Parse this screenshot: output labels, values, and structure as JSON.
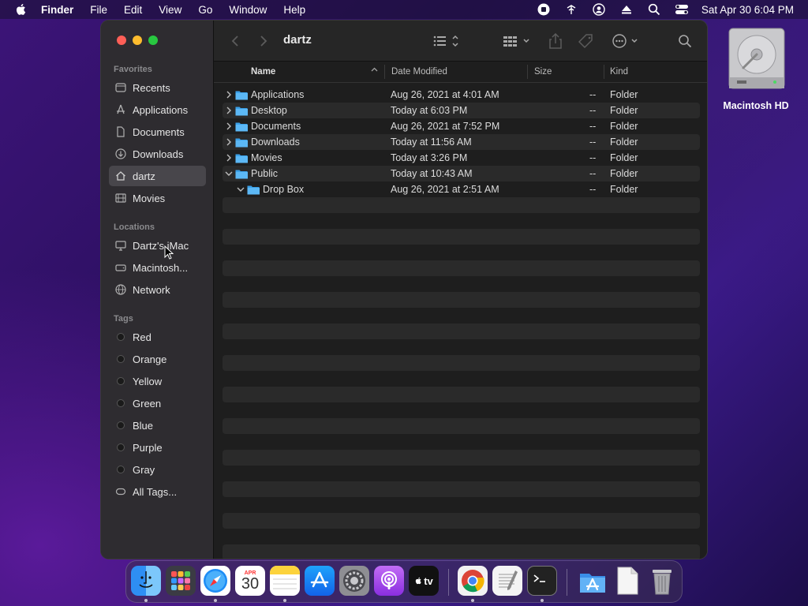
{
  "menubar": {
    "app": "Finder",
    "items": [
      "File",
      "Edit",
      "View",
      "Go",
      "Window",
      "Help"
    ],
    "clock": "Sat Apr 30  6:04 PM"
  },
  "desktop": {
    "disk_label": "Macintosh HD"
  },
  "window": {
    "title": "dartz",
    "sidebar": {
      "favorites_label": "Favorites",
      "favorites": [
        {
          "label": "Recents",
          "icon": "clock-icon"
        },
        {
          "label": "Applications",
          "icon": "applications-icon"
        },
        {
          "label": "Documents",
          "icon": "document-icon"
        },
        {
          "label": "Downloads",
          "icon": "download-icon"
        },
        {
          "label": "dartz",
          "icon": "home-icon",
          "active": true
        },
        {
          "label": "Movies",
          "icon": "film-icon"
        }
      ],
      "locations_label": "Locations",
      "locations": [
        {
          "label": "Dartz's iMac",
          "icon": "imac-icon"
        },
        {
          "label": "Macintosh...",
          "icon": "disk-icon"
        },
        {
          "label": "Network",
          "icon": "globe-icon"
        }
      ],
      "tags_label": "Tags",
      "tags": [
        "Red",
        "Orange",
        "Yellow",
        "Green",
        "Blue",
        "Purple",
        "Gray"
      ],
      "all_tags": "All Tags..."
    },
    "columns": {
      "name": "Name",
      "date": "Date Modified",
      "size": "Size",
      "kind": "Kind"
    },
    "rows": [
      {
        "name": "Applications",
        "date": "Aug 26, 2021 at 4:01 AM",
        "size": "--",
        "kind": "Folder",
        "expanded": false,
        "indent": 0
      },
      {
        "name": "Desktop",
        "date": "Today at 6:03 PM",
        "size": "--",
        "kind": "Folder",
        "expanded": false,
        "indent": 0
      },
      {
        "name": "Documents",
        "date": "Aug 26, 2021 at 7:52 PM",
        "size": "--",
        "kind": "Folder",
        "expanded": false,
        "indent": 0
      },
      {
        "name": "Downloads",
        "date": "Today at 11:56 AM",
        "size": "--",
        "kind": "Folder",
        "expanded": false,
        "indent": 0
      },
      {
        "name": "Movies",
        "date": "Today at 3:26 PM",
        "size": "--",
        "kind": "Folder",
        "expanded": false,
        "indent": 0
      },
      {
        "name": "Public",
        "date": "Today at 10:43 AM",
        "size": "--",
        "kind": "Folder",
        "expanded": true,
        "indent": 0
      },
      {
        "name": "Drop Box",
        "date": "Aug 26, 2021 at 2:51 AM",
        "size": "--",
        "kind": "Folder",
        "expanded": true,
        "indent": 1
      }
    ]
  },
  "dock": {
    "apps": [
      {
        "icon": "finder-icon",
        "running": true
      },
      {
        "icon": "launchpad-icon",
        "running": false
      },
      {
        "icon": "safari-icon",
        "running": true
      },
      {
        "icon": "calendar-icon",
        "running": false,
        "month": "APR",
        "day": "30"
      },
      {
        "icon": "notes-icon",
        "running": true
      },
      {
        "icon": "app-store-icon",
        "running": false
      },
      {
        "icon": "system-preferences-icon",
        "running": false
      },
      {
        "icon": "podcasts-icon",
        "running": false
      },
      {
        "icon": "apple-tv-icon",
        "running": false,
        "label": "tv"
      },
      {
        "icon": "chrome-icon",
        "running": true
      },
      {
        "icon": "textedit-icon",
        "running": false
      },
      {
        "icon": "terminal-icon",
        "running": true
      },
      {
        "icon": "app-store-folder-icon",
        "running": false
      },
      {
        "icon": "file-icon",
        "running": false
      },
      {
        "icon": "trash-icon",
        "running": false
      }
    ],
    "colors": {
      "finder": "#2d8ef2",
      "folder": "#3aa0e8"
    }
  }
}
